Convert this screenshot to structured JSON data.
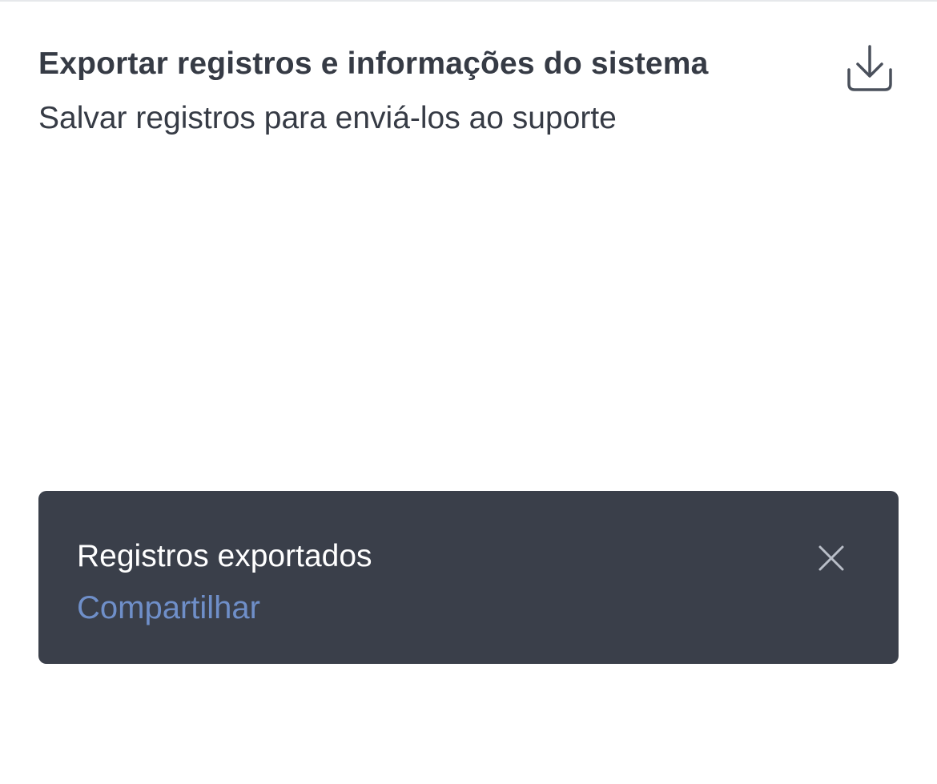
{
  "export_item": {
    "title": "Exportar registros e informações do sistema",
    "subtitle": "Salvar registros para enviá-los ao suporte",
    "icon": "download-icon"
  },
  "toast": {
    "message": "Registros exportados",
    "action_label": "Compartilhar",
    "close_icon": "close-icon"
  },
  "colors": {
    "text_primary": "#363b45",
    "toast_background": "#3a3f4a",
    "toast_text": "#ffffff",
    "action_link": "#6f8fc9"
  }
}
